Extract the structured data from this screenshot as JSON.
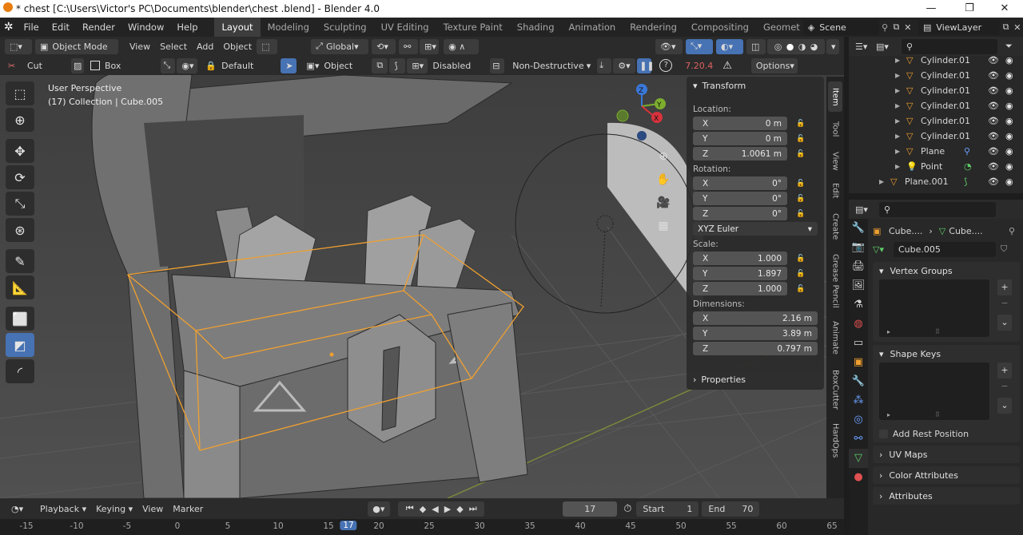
{
  "window": {
    "title": "* chest  [C:\\Users\\Victor's PC\\Documents\\blender\\chest .blend] - Blender 4.0",
    "minimize": "—",
    "maximize": "❐",
    "close": "✕"
  },
  "menu": [
    "File",
    "Edit",
    "Render",
    "Window",
    "Help"
  ],
  "workspaces": [
    "Layout",
    "Modeling",
    "Sculpting",
    "UV Editing",
    "Texture Paint",
    "Shading",
    "Animation",
    "Rendering",
    "Compositing",
    "Geomet"
  ],
  "scene": "Scene",
  "view_layer": "ViewLayer",
  "header": {
    "mode": "Object Mode",
    "menus": [
      "View",
      "Select",
      "Add",
      "Object"
    ],
    "transform": "Global"
  },
  "tool_header": {
    "cut": "Cut",
    "box": "Box",
    "default": "Default",
    "object": "Object",
    "disabled": "Disabled",
    "non_destructive": "Non-Destructive",
    "version": "7.20.4",
    "options": "Options"
  },
  "viewport": {
    "view_name": "User Perspective",
    "collection": "(17) Collection | Cube.005",
    "axis_x": "X",
    "axis_y": "Y",
    "axis_z": "Z"
  },
  "npanel": {
    "transform": "Transform",
    "location": "Location:",
    "rotation": "Rotation:",
    "rot_mode": "XYZ Euler",
    "scale": "Scale:",
    "dimensions": "Dimensions:",
    "properties": "Properties",
    "loc": [
      {
        "a": "X",
        "v": "0 m"
      },
      {
        "a": "Y",
        "v": "0 m"
      },
      {
        "a": "Z",
        "v": "1.0061 m"
      }
    ],
    "rot": [
      {
        "a": "X",
        "v": "0°"
      },
      {
        "a": "Y",
        "v": "0°"
      },
      {
        "a": "Z",
        "v": "0°"
      }
    ],
    "scl": [
      {
        "a": "X",
        "v": "1.000"
      },
      {
        "a": "Y",
        "v": "1.897"
      },
      {
        "a": "Z",
        "v": "1.000"
      }
    ],
    "dim": [
      {
        "a": "X",
        "v": "2.16 m"
      },
      {
        "a": "Y",
        "v": "3.89 m"
      },
      {
        "a": "Z",
        "v": "0.797 m"
      }
    ]
  },
  "vtabs": [
    "Item",
    "Tool",
    "View",
    "Edit",
    "Create",
    "Grease Pencil",
    "Animate",
    "BoxCutter",
    "HardOps"
  ],
  "outliner": {
    "items": [
      "Cylinder.01",
      "Cylinder.01",
      "Cylinder.01",
      "Cylinder.01",
      "Cylinder.01",
      "Cylinder.01",
      "Plane",
      "Point",
      "Plane.001"
    ]
  },
  "properties": {
    "breadcrumb1": "Cube....",
    "breadcrumb2": "Cube....",
    "mesh_name": "Cube.005",
    "vertex_groups": "Vertex Groups",
    "shape_keys": "Shape Keys",
    "add_rest_position": "Add Rest Position",
    "uv_maps": "UV Maps",
    "color_attributes": "Color Attributes",
    "attributes": "Attributes"
  },
  "timeline": {
    "playback": "Playback",
    "keying": "Keying",
    "view": "View",
    "marker": "Marker",
    "current_frame": "17",
    "start_label": "Start",
    "start": "1",
    "end_label": "End",
    "end": "70"
  },
  "ruler": {
    "labels": [
      "-15",
      "-10",
      "-5",
      "0",
      "5",
      "10",
      "15",
      "17",
      "20",
      "25",
      "30",
      "35",
      "40",
      "45",
      "50",
      "55",
      "60",
      "65"
    ]
  }
}
